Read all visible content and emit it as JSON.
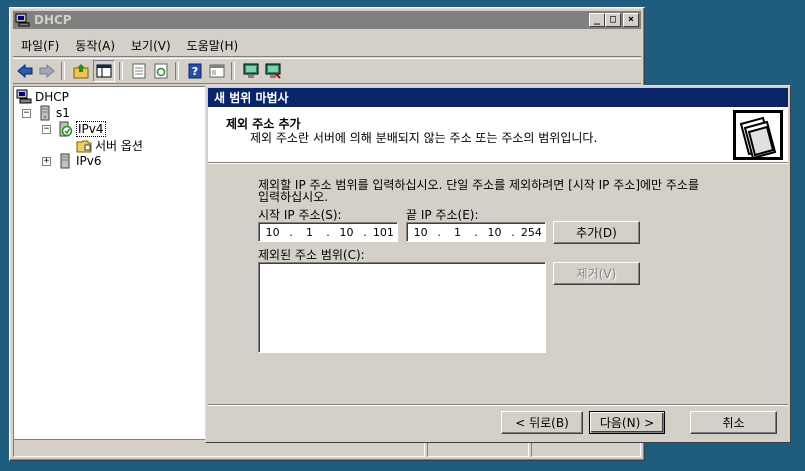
{
  "window": {
    "title": "DHCP",
    "controls": {
      "minimize": "_",
      "restore": "□",
      "close": "×"
    }
  },
  "menu": [
    "파일(F)",
    "동작(A)",
    "보기(V)",
    "도움말(H)"
  ],
  "toolbar": {
    "icons": [
      "back-icon",
      "forward-icon",
      "up-icon",
      "show-tree-icon",
      "export-icon",
      "refresh-icon",
      "help-icon",
      "properties-icon",
      "server-icon",
      "server-add-icon"
    ]
  },
  "tree": {
    "root": "DHCP",
    "server": "s1",
    "ipv4": "IPv4",
    "server_options": "서버 옵션",
    "ipv6": "IPv6"
  },
  "wizard": {
    "title": "새 범위 마법사",
    "header_title": "제외 주소 추가",
    "header_subtitle": "제외 주소란 서버에 의해 분배되지 않는 주소 또는 주소의 범위입니다.",
    "instructions_line1": "제외할 IP 주소 범위를 입력하십시오. 단일 주소를 제외하려면 [시작 IP 주소]에만 주소를",
    "instructions_line2": "입력하십시오.",
    "start_ip_label": "시작 IP 주소(S):",
    "end_ip_label": "끝 IP 주소(E):",
    "start_ip": [
      "10",
      "1",
      "10",
      "101"
    ],
    "end_ip": [
      "10",
      "1",
      "10",
      "254"
    ],
    "add_button": "추가(D)",
    "excluded_label": "제외된 주소 범위(C):",
    "remove_button": "제거(V)",
    "back_button": "< 뒤로(B)",
    "next_button": "다음(N) >",
    "cancel_button": "취소"
  }
}
